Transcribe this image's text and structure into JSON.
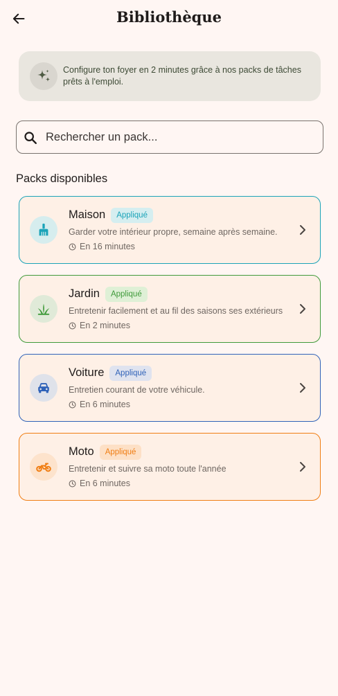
{
  "header": {
    "title": "Bibliothèque",
    "back_icon": "arrow-left-icon"
  },
  "info": {
    "icon": "sparkles-icon",
    "text": "Configure ton foyer en 2 minutes grâce à nos packs de tâches prêts à l'emploi."
  },
  "search": {
    "placeholder": "Rechercher un pack...",
    "value": "",
    "icon": "search-icon"
  },
  "section": {
    "title": "Packs disponibles"
  },
  "packs": [
    {
      "name": "Maison",
      "badge": "Appliqué",
      "description": "Garder votre intérieur propre, semaine après semaine.",
      "duration": "En 16 minutes",
      "icon": "broom-icon",
      "color": "#1aa3b8",
      "badge_bg": "#d5eef0",
      "avatar_bg": "#d6edee"
    },
    {
      "name": "Jardin",
      "badge": "Appliqué",
      "description": "Entretenir facilement et au fil des saisons ses extérieurs",
      "duration": "En 2 minutes",
      "icon": "grass-icon",
      "color": "#3f9a3a",
      "badge_bg": "#dff0d6",
      "avatar_bg": "#e0ead8"
    },
    {
      "name": "Voiture",
      "badge": "Appliqué",
      "description": "Entretien courant de votre véhicule.",
      "duration": "En 6 minutes",
      "icon": "car-icon",
      "color": "#2f62b8",
      "badge_bg": "#dfe3ef",
      "avatar_bg": "#dfe2ea"
    },
    {
      "name": "Moto",
      "badge": "Appliqué",
      "description": "Entretenir et suivre sa moto toute l'année",
      "duration": "En 6 minutes",
      "icon": "motorcycle-icon",
      "color": "#f07d12",
      "badge_bg": "#fde0c6",
      "avatar_bg": "#fde3cc"
    }
  ]
}
